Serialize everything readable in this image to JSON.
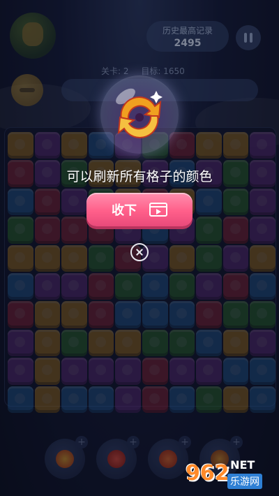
{
  "header": {
    "record_label": "历史最高记录",
    "record_value": "2495",
    "level_label": "关卡: 2",
    "target_label": "目标: 1650"
  },
  "board": {
    "rows": 10,
    "cols": 10,
    "tiles": [
      [
        "yellow",
        "purple",
        "yellow",
        "blue",
        "purple",
        "green",
        "red",
        "yellow",
        "yellow",
        "purple"
      ],
      [
        "red",
        "purple",
        "green",
        "yellow",
        "yellow",
        "purple",
        "blue",
        "purple",
        "green",
        "purple"
      ],
      [
        "blue",
        "red",
        "purple",
        "green",
        "yellow",
        "red",
        "yellow",
        "blue",
        "green",
        "purple"
      ],
      [
        "green",
        "red",
        "red",
        "red",
        "purple",
        "blue",
        "purple",
        "green",
        "red",
        "purple"
      ],
      [
        "yellow",
        "yellow",
        "yellow",
        "green",
        "red",
        "purple",
        "yellow",
        "green",
        "purple",
        "yellow"
      ],
      [
        "blue",
        "purple",
        "purple",
        "red",
        "green",
        "blue",
        "green",
        "purple",
        "red",
        "blue"
      ],
      [
        "red",
        "yellow",
        "yellow",
        "red",
        "blue",
        "blue",
        "blue",
        "red",
        "green",
        "green"
      ],
      [
        "purple",
        "yellow",
        "green",
        "yellow",
        "yellow",
        "green",
        "green",
        "blue",
        "yellow",
        "purple"
      ],
      [
        "purple",
        "yellow",
        "purple",
        "purple",
        "purple",
        "red",
        "purple",
        "purple",
        "blue",
        "blue"
      ],
      [
        "blue",
        "yellow",
        "blue",
        "blue",
        "purple",
        "red",
        "blue",
        "green",
        "yellow",
        "blue"
      ]
    ],
    "colors": {
      "yellow": "#e6a326",
      "purple": "#8a3fb0",
      "blue": "#2f7fcf",
      "green": "#3f9a3a",
      "red": "#c8324a"
    }
  },
  "popup": {
    "icon": "refresh-icon",
    "description": "可以刷新所有格子的颜色",
    "collect_label": "收下",
    "collect_icon": "video-ad-icon",
    "close_icon": "close-icon"
  },
  "powerups": [
    {
      "icon": "refresh-icon",
      "plus": "+"
    },
    {
      "icon": "hammer-icon",
      "plus": "+"
    },
    {
      "icon": "bomb-icon",
      "plus": "+"
    },
    {
      "icon": "magic-icon",
      "plus": "+"
    }
  ],
  "watermark": {
    "number": "962",
    "suffix": ".NET",
    "site": "乐游网"
  }
}
